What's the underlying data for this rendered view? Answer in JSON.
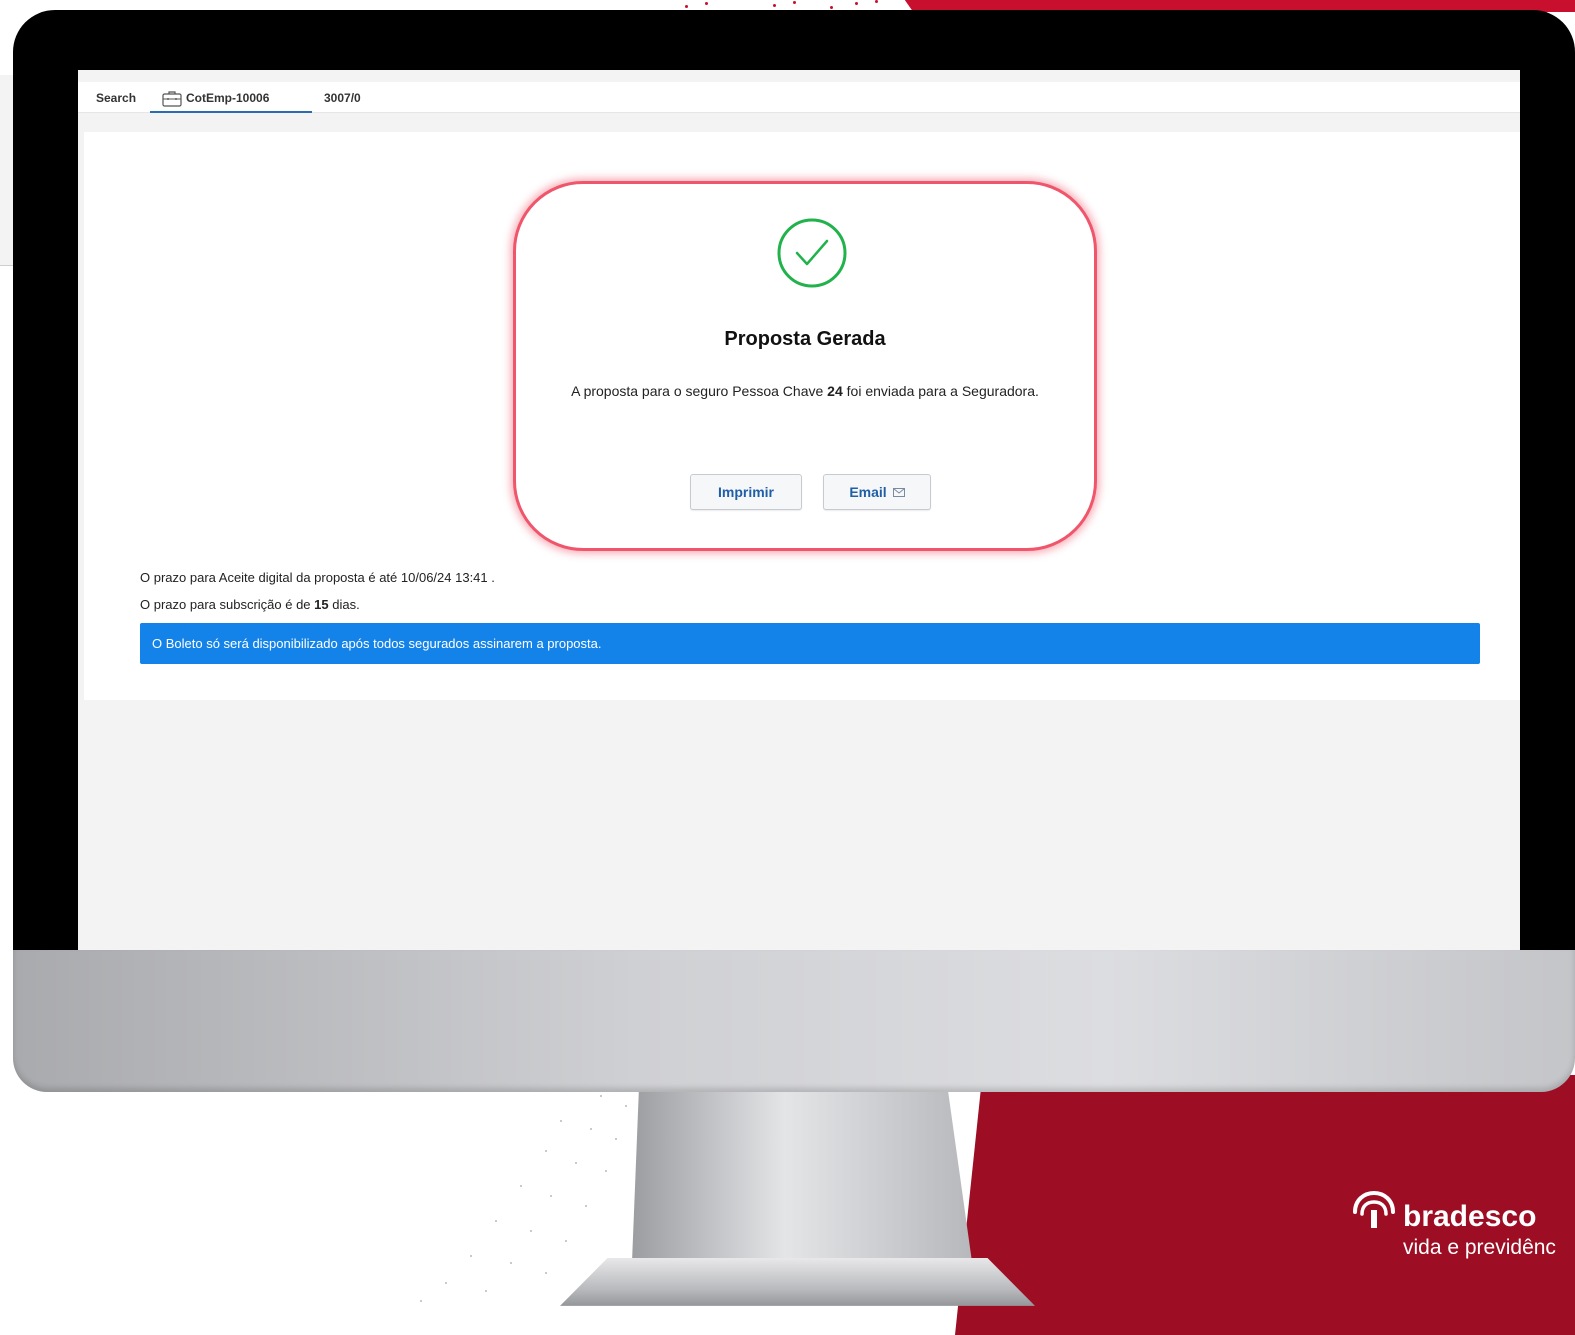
{
  "app": {
    "search_label": "Search",
    "tab_label": "CotEmp-10006",
    "record_id": "3007/0"
  },
  "result": {
    "title": "Proposta Gerada",
    "message_before": "A proposta para o seguro Pessoa Chave ",
    "message_number": "24",
    "message_after": " foi enviada para a Seguradora.",
    "print_button": "Imprimir",
    "email_button": "Email"
  },
  "info": {
    "deadline_text": "O prazo para Aceite digital da proposta é até 10/06/24 13:41 .",
    "subscription_before": "O prazo para subscrição é de ",
    "subscription_days": "15",
    "subscription_after": " dias.",
    "alert_text": "O Boleto só será disponibilizado após todos segurados assinarem a proposta."
  },
  "branding": {
    "brand": "bradesco",
    "tagline": "vida e previdênc"
  },
  "icons": {
    "tab": "briefcase-icon",
    "success": "check-circle-icon",
    "email": "envelope-icon",
    "logo": "bradesco-tree-logo"
  },
  "colors": {
    "accent_red": "#c8102e",
    "dark_red": "#9d0e24",
    "card_border": "#f0566b",
    "success_green": "#22b24c",
    "alert_blue": "#1383ea",
    "button_text": "#1f5fa8"
  }
}
